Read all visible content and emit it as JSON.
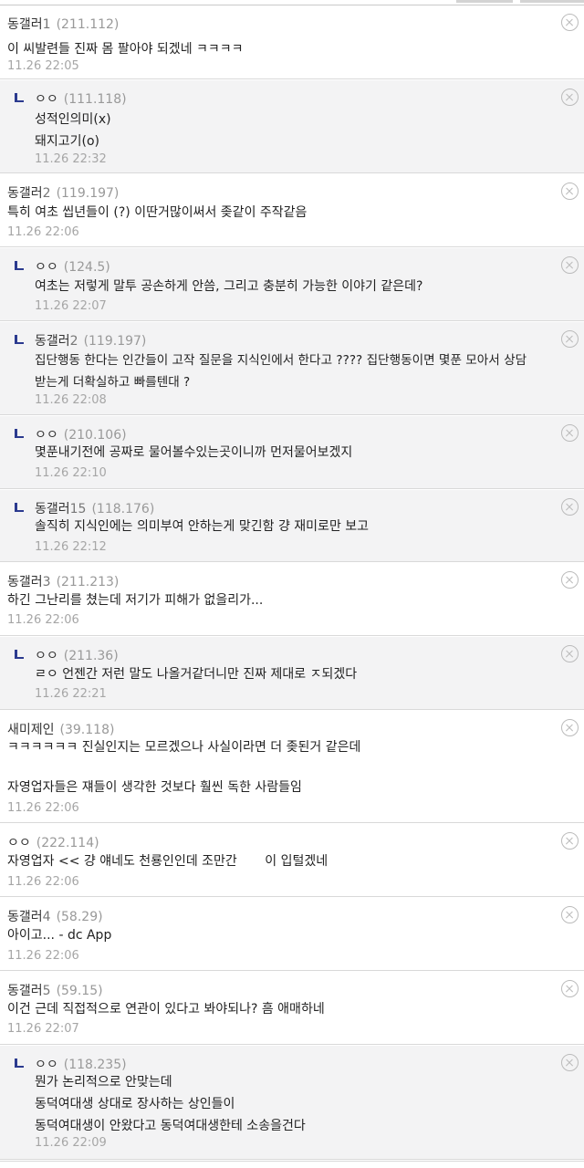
{
  "comments": [
    {
      "nick": "동갤러",
      "num": "1",
      "ip": "(211.112)",
      "lines": [
        "이 씨발련들 진짜 몸 팔아야 되겠네 ㅋㅋㅋㅋ"
      ],
      "date": "11.26 22:05",
      "reply": false
    },
    {
      "nick": "ㅇㅇ",
      "num": "",
      "ip": "(111.118)",
      "lines": [
        "성적인의미(x)",
        "돼지고기(o)"
      ],
      "date": "11.26 22:32",
      "reply": true
    },
    {
      "nick": "동갤러",
      "num": "2",
      "ip": "(119.197)",
      "lines": [
        "특히 여초 씹년들이 (?) 이딴거많이써서 좆같이 주작같음"
      ],
      "date": "11.26 22:06",
      "reply": false
    },
    {
      "nick": "ㅇㅇ",
      "num": "",
      "ip": "(124.5)",
      "lines": [
        "여초는 저렇게 말투 공손하게 안씀, 그리고 충분히 가능한 이야기 같은데?"
      ],
      "date": "11.26 22:07",
      "reply": true
    },
    {
      "nick": "동갤러",
      "num": "2",
      "ip": "(119.197)",
      "lines": [
        "집단행동 한다는 인간들이 고작 질문을 지식인에서 한다고 ???? 집단행동이면 몇푼 모아서 상담",
        "받는게 더확실하고 빠를텐대 ?"
      ],
      "date": "11.26 22:08",
      "reply": true
    },
    {
      "nick": "ㅇㅇ",
      "num": "",
      "ip": "(210.106)",
      "lines": [
        "몇푼내기전에 공짜로 물어볼수있는곳이니까 먼저물어보겠지"
      ],
      "date": "11.26 22:10",
      "reply": true
    },
    {
      "nick": "동갤러",
      "num": "15",
      "ip": "(118.176)",
      "lines": [
        "솔직히 지식인에는 의미부여 안하는게 맞긴함 걍 재미로만 보고"
      ],
      "date": "11.26 22:12",
      "reply": true
    },
    {
      "nick": "동갤러",
      "num": "3",
      "ip": "(211.213)",
      "lines": [
        "하긴 그난리를 쳤는데 저기가 피해가 없을리가..."
      ],
      "date": "11.26 22:06",
      "reply": false
    },
    {
      "nick": "ㅇㅇ",
      "num": "",
      "ip": "(211.36)",
      "lines": [
        "ㄹㅇ 언젠간 저런 말도 나올거같더니만 진짜 제대로 ㅈ되겠다"
      ],
      "date": "11.26 22:21",
      "reply": true
    },
    {
      "nick": "새미제인",
      "num": "",
      "ip": "(39.118)",
      "lines": [
        "ㅋㅋㅋㅋㅋㅋ 진실인지는 모르겠으나 사실이라면 더 좆된거 같은데",
        "",
        "자영업자들은 쟤들이 생각한 것보다 훨씬 독한 사람들임"
      ],
      "date": "11.26 22:06",
      "reply": false
    },
    {
      "nick": "ㅇㅇ",
      "num": "",
      "ip": "(222.114)",
      "lines_masked": [
        "자영업자 << 걍 얘네도 천룡인인데 조만간 ",
        "이 입털겠네"
      ],
      "date": "11.26 22:06",
      "reply": false
    },
    {
      "nick": "동갤러",
      "num": "4",
      "ip": "(58.29)",
      "lines": [
        "아이고... - dc App"
      ],
      "date": "11.26 22:06",
      "reply": false
    },
    {
      "nick": "동갤러",
      "num": "5",
      "ip": "(59.15)",
      "lines": [
        "이건 근데 직접적으로 연관이 있다고 봐야되나? 흠 애매하네"
      ],
      "date": "11.26 22:07",
      "reply": false
    },
    {
      "nick": "ㅇㅇ",
      "num": "",
      "ip": "(118.235)",
      "lines": [
        "뭔가 논리적으로 안맞는데",
        "동덕여대생 상대로 장사하는 상인들이",
        "동덕여대생이 안왔다고 동덕여대생한테 소송을건다"
      ],
      "date": "11.26 22:09",
      "reply": true
    }
  ]
}
